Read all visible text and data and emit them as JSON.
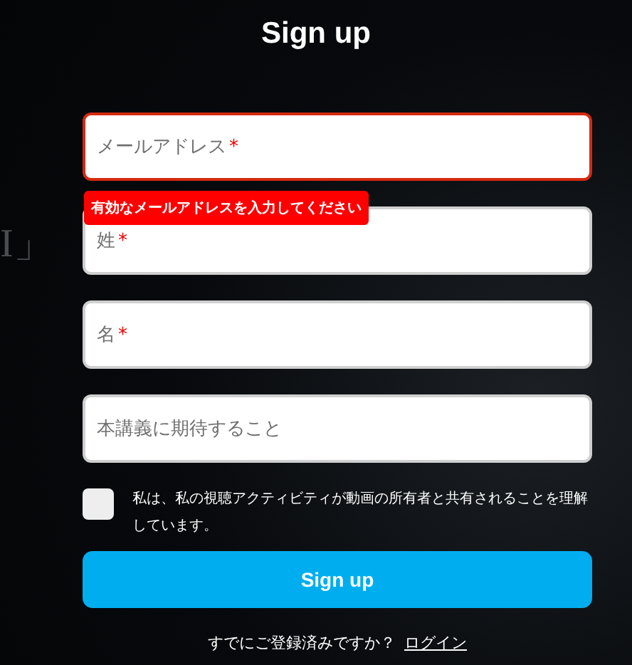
{
  "background_text": "I」",
  "title": "Sign up",
  "fields": [
    {
      "placeholder": "メールアドレス",
      "required_mark": "*",
      "invalid": true,
      "error": "有効なメールアドレスを入力してください"
    },
    {
      "placeholder": "姓",
      "required_mark": "*",
      "invalid": false
    },
    {
      "placeholder": "名",
      "required_mark": "*",
      "invalid": false
    },
    {
      "placeholder": "本講義に期待すること",
      "invalid": false
    }
  ],
  "consent": {
    "checked": false,
    "label": "私は、私の視聴アクティビティが動画の所有者と共有されることを理解しています。"
  },
  "submit": "Sign up",
  "footer": {
    "text": "すでにご登録済みですか？",
    "link": "ログイン"
  }
}
